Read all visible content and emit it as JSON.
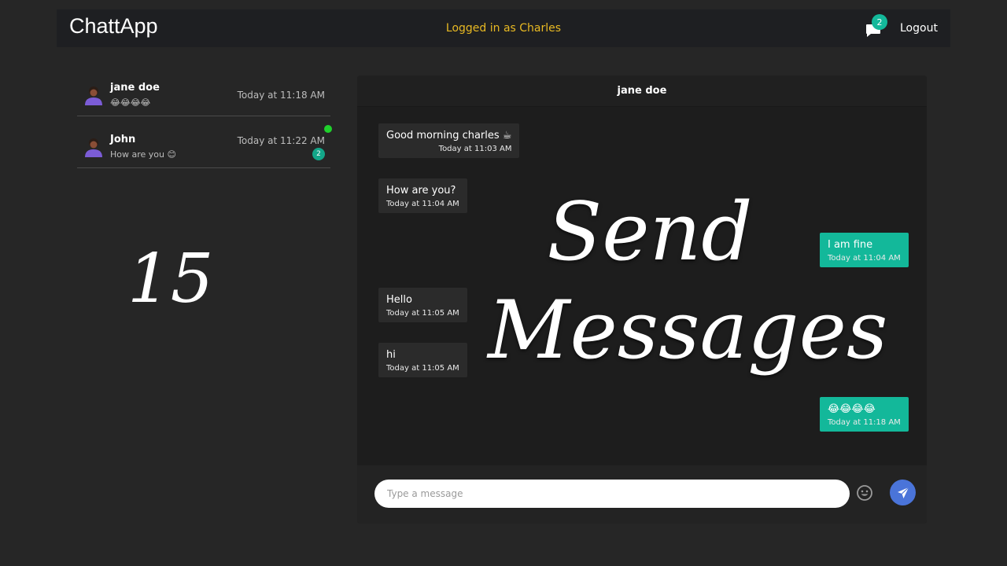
{
  "header": {
    "brand": "ChattApp",
    "logged_in_text": "Logged in as Charles",
    "notification_count": "2",
    "logout_label": "Logout"
  },
  "conversations": [
    {
      "name": "jane doe",
      "preview": "😂😂😂😂",
      "time": "Today at 11:18 AM"
    },
    {
      "name": "John",
      "preview": "How are you 😊",
      "time": "Today at 11:22 AM",
      "unread": "2",
      "online": true
    }
  ],
  "chat": {
    "header_name": "jane doe",
    "messages": [
      {
        "text": "Good morning charles ☕",
        "time": "Today at 11:03 AM",
        "mine": false
      },
      {
        "text": "How are you?",
        "time": "Today at 11:04 AM",
        "mine": false
      },
      {
        "text": "I am fine",
        "time": "Today at 11:04 AM",
        "mine": true
      },
      {
        "text": "Hello",
        "time": "Today at 11:05 AM",
        "mine": false
      },
      {
        "text": "hi",
        "time": "Today at 11:05 AM",
        "mine": false
      },
      {
        "text": "😂😂😂😂",
        "time": "Today at 11:18 AM",
        "mine": true
      }
    ],
    "input_placeholder": "Type a message",
    "input_value": ""
  },
  "overlay": {
    "episode_number": "15",
    "title_line1": "Send",
    "title_line2": "Messages"
  },
  "colors": {
    "accent": "#13b89a",
    "send_button": "#4a74d9",
    "logged_in_text": "#e8b923",
    "online": "#1fd12c"
  }
}
